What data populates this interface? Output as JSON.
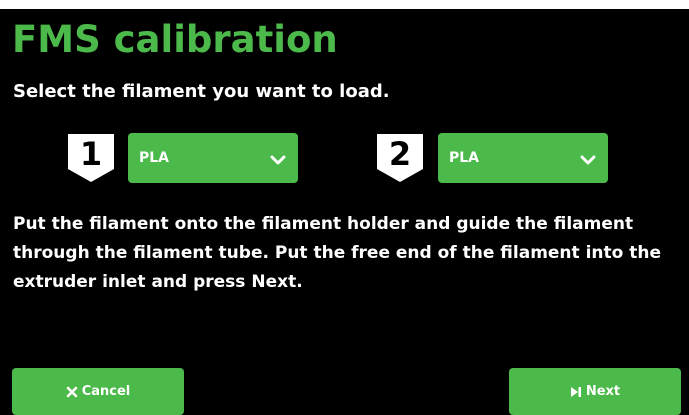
{
  "header": {
    "title": "FMS calibration",
    "subtitle": "Select the filament you want to load."
  },
  "slots": [
    {
      "number": "1",
      "filament": "PLA",
      "icon": "chevron-down-icon"
    },
    {
      "number": "2",
      "filament": "PLA",
      "icon": "chevron-down-icon"
    }
  ],
  "instructions": "Put the filament onto the filament holder and guide the filament through the filament tube. Put the free end of the filament into the extruder inlet and press Next.",
  "buttons": {
    "cancel_label": "Cancel",
    "cancel_icon": "close-icon",
    "next_label": "Next",
    "next_icon": "skip-next-icon"
  },
  "colors": {
    "accent": "#4cba4a",
    "background": "#000000",
    "text": "#ffffff"
  }
}
